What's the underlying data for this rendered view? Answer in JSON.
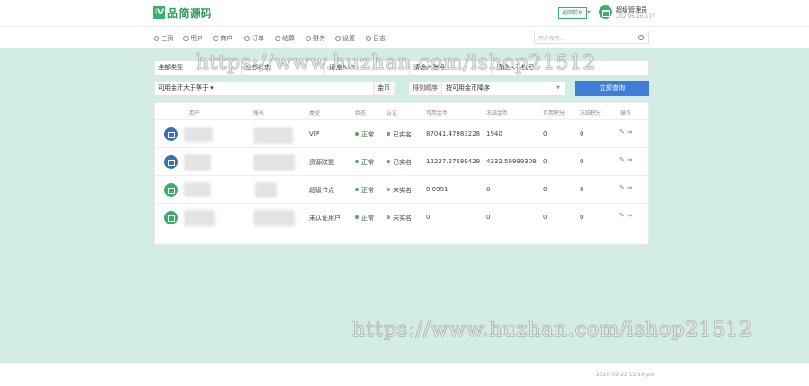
{
  "header": {
    "logo_mark": "IV",
    "logo_text": "品简源码",
    "back_button": "返回前台",
    "user_name": "超级管理员",
    "user_ip": "202.96.26.117"
  },
  "nav": {
    "items": [
      "主页",
      "用户",
      "商户",
      "订单",
      "结算",
      "财务",
      "设置",
      "日志"
    ],
    "search_placeholder": "用户搜索..."
  },
  "filters": {
    "group_select": "全部类型",
    "field2": "全部状态",
    "field3": "请输入ID",
    "field4": "请输入账号",
    "field5": "请输入手机号",
    "amount_select": "可用金币大于等于",
    "amount_unit": "金币",
    "sort_label": "排列顺序",
    "sort_select": "按可用金币降序",
    "search_button": "立即查询"
  },
  "table": {
    "headers": [
      "用户",
      "账号",
      "类型",
      "状态",
      "认证",
      "可用金币",
      "冻结金币",
      "可用积分",
      "冻结积分",
      "操作"
    ],
    "rows": [
      {
        "type": "VIP",
        "status": "正常",
        "auth": "已实名",
        "auth_ok": true,
        "gold": "87041.47983228",
        "frozen": "1940",
        "points": "0",
        "frozen_points": "0",
        "avatar": "blue"
      },
      {
        "type": "资源联盟",
        "status": "正常",
        "auth": "已实名",
        "auth_ok": true,
        "gold": "12227.27589429",
        "frozen": "4332.59999309",
        "points": "0",
        "frozen_points": "0",
        "avatar": "blue"
      },
      {
        "type": "超级节点",
        "status": "正常",
        "auth": "未实名",
        "auth_ok": false,
        "gold": "0.0991",
        "frozen": "0",
        "points": "0",
        "frozen_points": "0",
        "avatar": "green"
      },
      {
        "type": "未认证用户",
        "status": "正常",
        "auth": "未实名",
        "auth_ok": false,
        "gold": "0",
        "frozen": "0",
        "points": "0",
        "frozen_points": "0",
        "avatar": "green"
      }
    ],
    "op_edit": "✎",
    "op_more": "⇥"
  },
  "footer": {
    "timestamp": "2020-02-22 12:14 pm"
  },
  "watermark": "https://www.huzhan.com/ishop21512",
  "colors": {
    "primary": "#3f7dd6",
    "green": "#3bae6c",
    "ok": "#4caf50",
    "pending": "#9e9e9e"
  }
}
